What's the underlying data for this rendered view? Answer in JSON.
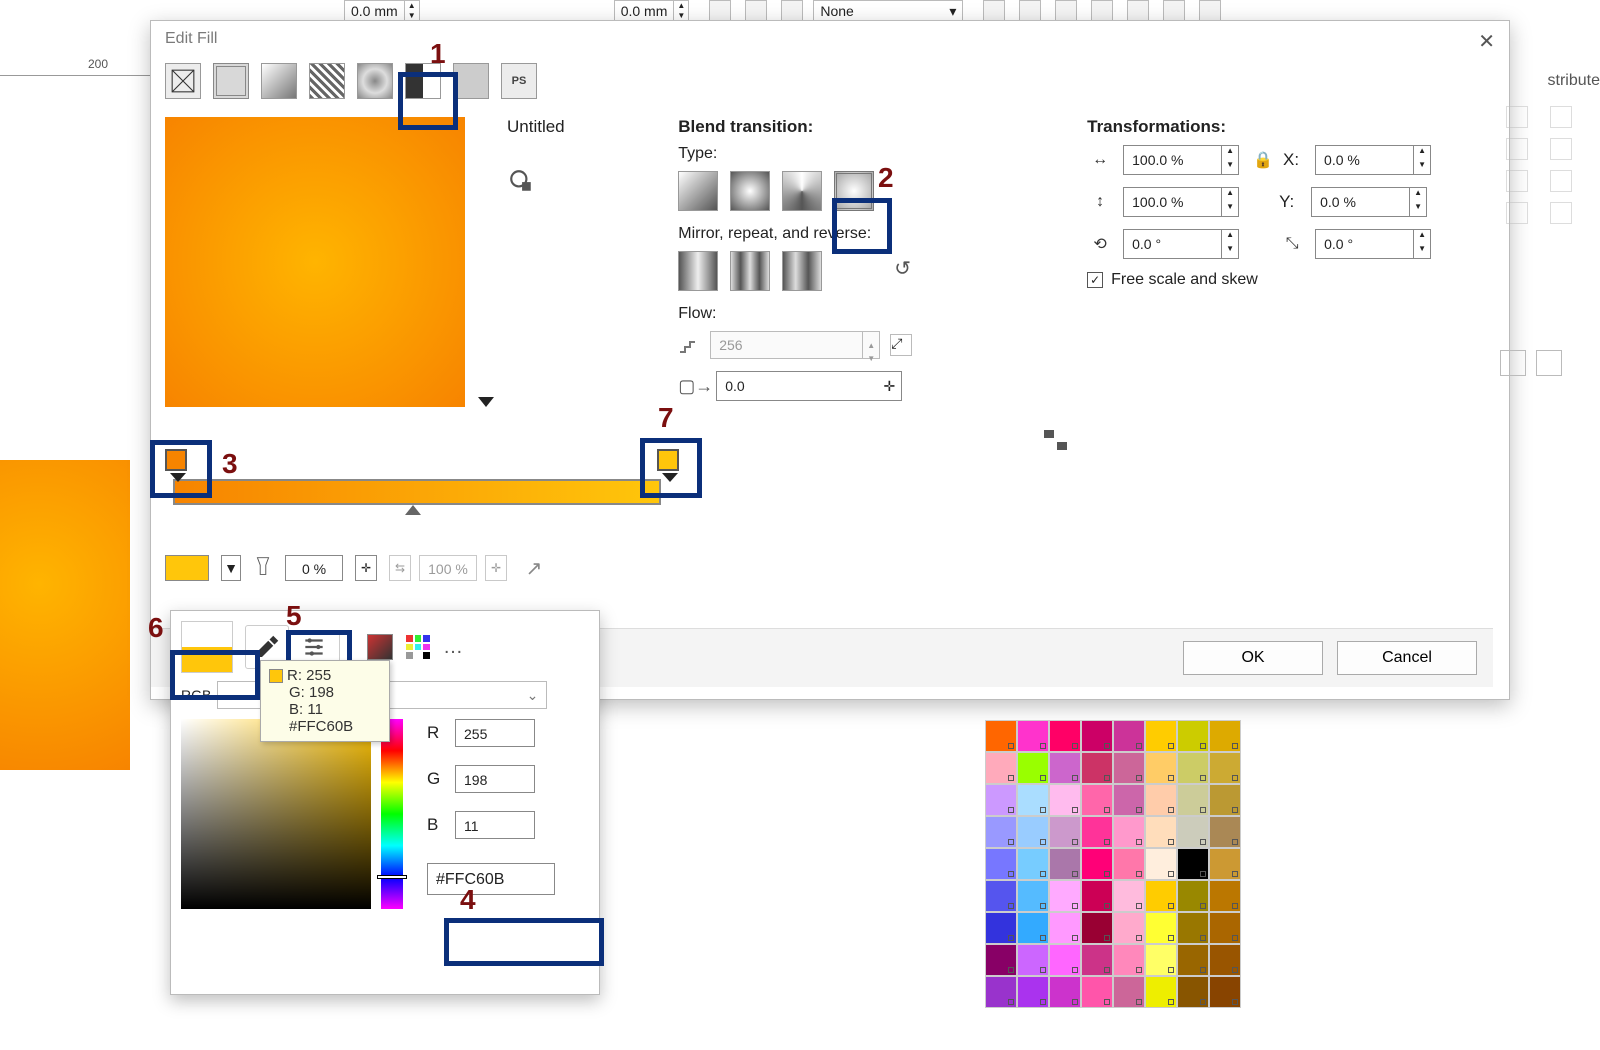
{
  "topbar": {
    "val1": "0.0 mm",
    "val2": "0.0 mm",
    "none": "None"
  },
  "ruler": {
    "label": "200"
  },
  "dialog": {
    "title": "Edit Fill",
    "preview_name": "Untitled",
    "blend": {
      "title": "Blend transition:",
      "type_label": "Type:",
      "mirror_label": "Mirror, repeat, and reverse:",
      "flow_label": "Flow:",
      "flow_steps": "256",
      "pos": "0.0"
    },
    "node": {
      "opacity": "0 %",
      "blend": "100 %"
    },
    "trans": {
      "title": "Transformations:",
      "w": "100.0 %",
      "h": "100.0 %",
      "ang": "0.0 °",
      "x": "0.0 %",
      "y": "0.0 %",
      "skew": "0.0 °",
      "free": "Free scale and skew"
    },
    "ok": "OK",
    "cancel": "Cancel"
  },
  "picker": {
    "model": "RGB",
    "r_label": "R",
    "g_label": "G",
    "b_label": "B",
    "r": "255",
    "g": "198",
    "b": "11",
    "hex": "#FFC60B"
  },
  "tooltip": {
    "line1": "R: 255",
    "line2": "G: 198",
    "line3": "B: 11",
    "hex": "#FFC60B"
  },
  "rside": {
    "word": "stribute"
  },
  "annots": {
    "n1": "1",
    "n2": "2",
    "n3": "3",
    "n4": "4",
    "n5": "5",
    "n6": "6",
    "n7": "7"
  }
}
